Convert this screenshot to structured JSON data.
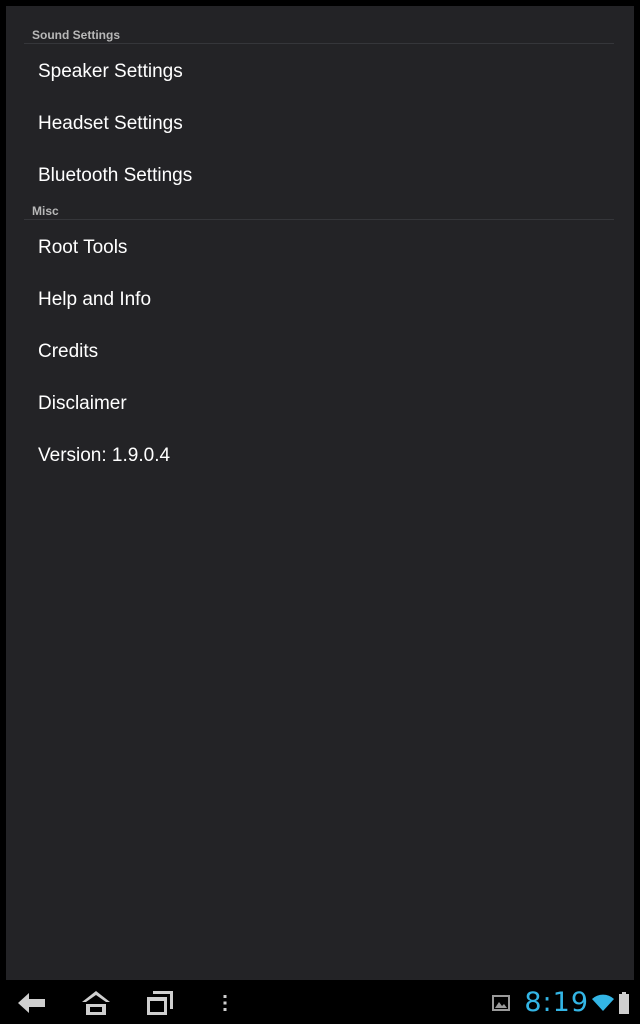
{
  "sections": [
    {
      "title": "Sound Settings",
      "items": [
        "Speaker Settings",
        "Headset Settings",
        "Bluetooth Settings"
      ]
    },
    {
      "title": "Misc",
      "items": [
        "Root Tools",
        "Help and Info",
        "Credits",
        "Disclaimer",
        "Version: 1.9.0.4"
      ]
    }
  ],
  "status_bar": {
    "time": "8:19"
  },
  "colors": {
    "background": "#232326",
    "clock": "#33b5e5",
    "text": "#ffffff",
    "header_text": "#b8b8b8"
  },
  "icons": {
    "nav": [
      "back-icon",
      "home-icon",
      "recent-apps-icon",
      "menu-overflow-icon"
    ],
    "status": [
      "gallery-notification-icon",
      "wifi-icon",
      "battery-icon"
    ]
  }
}
